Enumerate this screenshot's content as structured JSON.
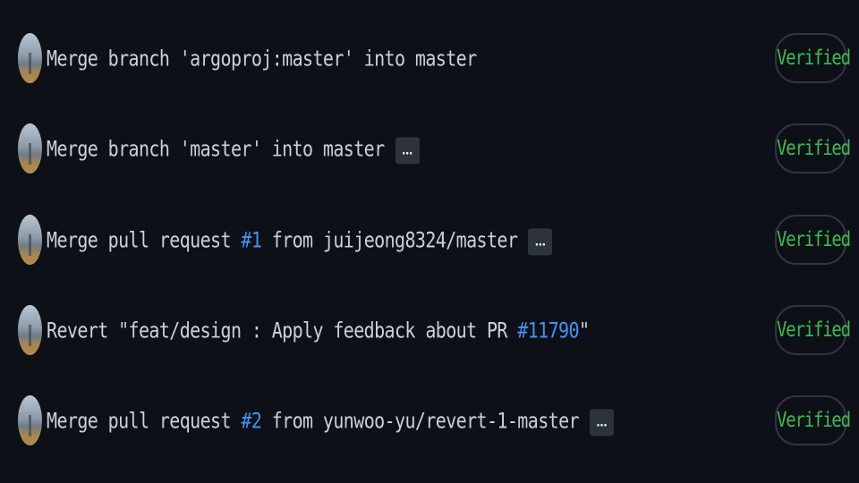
{
  "commits": [
    {
      "message_parts": [
        "Merge branch 'argoproj:master' into master"
      ],
      "pr_link": null,
      "message_suffix": "",
      "has_ellipsis": false,
      "ellipsis_label": "",
      "badge": "Verified"
    },
    {
      "message_parts": [
        "Merge branch 'master' into master"
      ],
      "pr_link": null,
      "message_suffix": "",
      "has_ellipsis": true,
      "ellipsis_label": "…",
      "badge": "Verified"
    },
    {
      "message_prefix": "Merge pull request ",
      "pr_link": "#1",
      "message_suffix": " from juijeong8324/master",
      "has_ellipsis": true,
      "ellipsis_label": "…",
      "badge": "Verified"
    },
    {
      "message_prefix": "Revert \"feat/design : Apply feedback about PR ",
      "pr_link": "#11790",
      "message_suffix": "\"",
      "has_ellipsis": false,
      "ellipsis_label": "",
      "badge": "Verified"
    },
    {
      "message_prefix": "Merge pull request ",
      "pr_link": "#2",
      "message_suffix": " from yunwoo-yu/revert-1-master",
      "has_ellipsis": true,
      "ellipsis_label": "…",
      "badge": "Verified"
    }
  ],
  "colors": {
    "background": "#0d1117",
    "text": "#c9d1d9",
    "link": "#4493f8",
    "verified": "#3fb950"
  },
  "icons": {
    "avatar": "user-avatar",
    "ellipsis": "more-horizontal-icon"
  }
}
